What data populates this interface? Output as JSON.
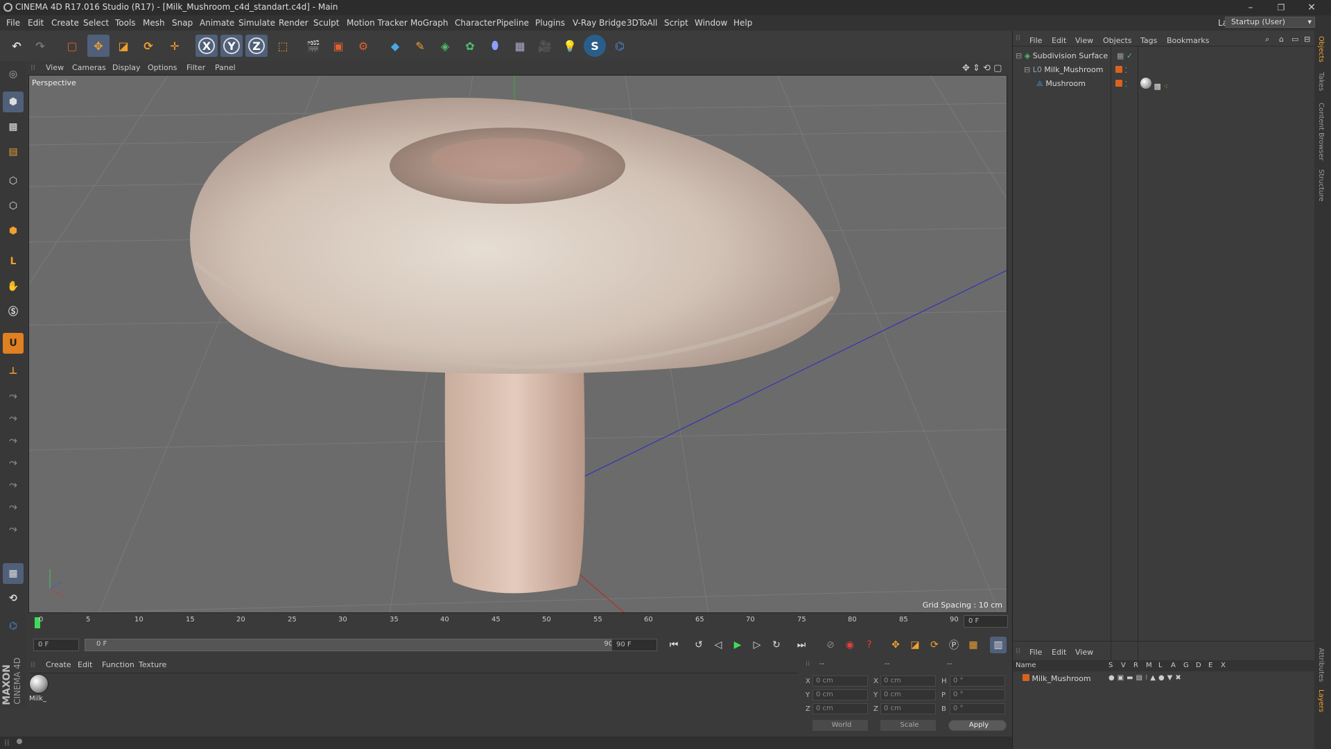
{
  "window": {
    "title": "CINEMA 4D R17.016 Studio (R17) - [Milk_Mushroom_c4d_standart.c4d] - Main",
    "minimize": "–",
    "restore": "❐",
    "close": "✕"
  },
  "menubar": {
    "items": [
      "File",
      "Edit",
      "Create",
      "Select",
      "Tools",
      "Mesh",
      "Snap",
      "Animate",
      "Simulate",
      "Render",
      "Sculpt",
      "Motion Tracker",
      "MoGraph",
      "Character",
      "Pipeline",
      "Plugins",
      "V-Ray Bridge",
      "3DToAll",
      "Script",
      "Window",
      "Help"
    ],
    "layout_label": "Layout:",
    "layout_value": "Startup (User)"
  },
  "toolbar": {
    "x_axis": "X",
    "y_axis": "Y",
    "z_axis": "Z"
  },
  "viewport": {
    "menu": [
      "View",
      "Cameras",
      "Display",
      "Options",
      "Filter",
      "Panel"
    ],
    "label": "Perspective",
    "grid_spacing": "Grid Spacing : 10 cm"
  },
  "timeline": {
    "ticks": [
      "0",
      "5",
      "10",
      "15",
      "20",
      "25",
      "30",
      "35",
      "40",
      "45",
      "50",
      "55",
      "60",
      "65",
      "70",
      "75",
      "80",
      "85",
      "90"
    ],
    "current_frame": "0 F",
    "start_frame": "0 F",
    "range_start": "0 F",
    "range_end": "90 F",
    "end_frame": "90 F"
  },
  "materials": {
    "menu": [
      "Create",
      "Edit",
      "Function",
      "Texture"
    ],
    "items": [
      {
        "label": "Milk_"
      }
    ]
  },
  "coords": {
    "header": [
      "--",
      "--",
      "--"
    ],
    "rows": [
      {
        "a": "X",
        "av": "0 cm",
        "b": "X",
        "bv": "0 cm",
        "c": "H",
        "cv": "0 °"
      },
      {
        "a": "Y",
        "av": "0 cm",
        "b": "Y",
        "bv": "0 cm",
        "c": "P",
        "cv": "0 °"
      },
      {
        "a": "Z",
        "av": "0 cm",
        "b": "Z",
        "bv": "0 cm",
        "c": "B",
        "cv": "0 °"
      }
    ],
    "world": "World",
    "scale": "Scale",
    "apply": "Apply"
  },
  "object_manager": {
    "menu": [
      "File",
      "Edit",
      "View",
      "Objects",
      "Tags",
      "Bookmarks"
    ],
    "objects": [
      {
        "name": "Subdivision Surface",
        "color": "#4fbf6a"
      },
      {
        "name": "Milk_Mushroom",
        "color": "#d8631e"
      },
      {
        "name": "Mushroom",
        "color": "#d8631e"
      }
    ]
  },
  "layer_manager": {
    "menu": [
      "File",
      "Edit",
      "View"
    ],
    "columns": [
      "Name",
      "S",
      "V",
      "R",
      "M",
      "L",
      "A",
      "G",
      "D",
      "E",
      "X"
    ],
    "rows": [
      {
        "name": "Milk_Mushroom",
        "color": "#d8631e"
      }
    ]
  },
  "side_tabs": [
    "Objects",
    "Takes",
    "Content Browser",
    "Structure"
  ],
  "side_tabs_bottom": [
    "Attributes",
    "Layers"
  ],
  "brand": {
    "maxon": "MAXON",
    "c4d": "CINEMA 4D"
  },
  "colors": {
    "accent": "#d8631e",
    "viewport_bg": "#6b6b6b"
  }
}
